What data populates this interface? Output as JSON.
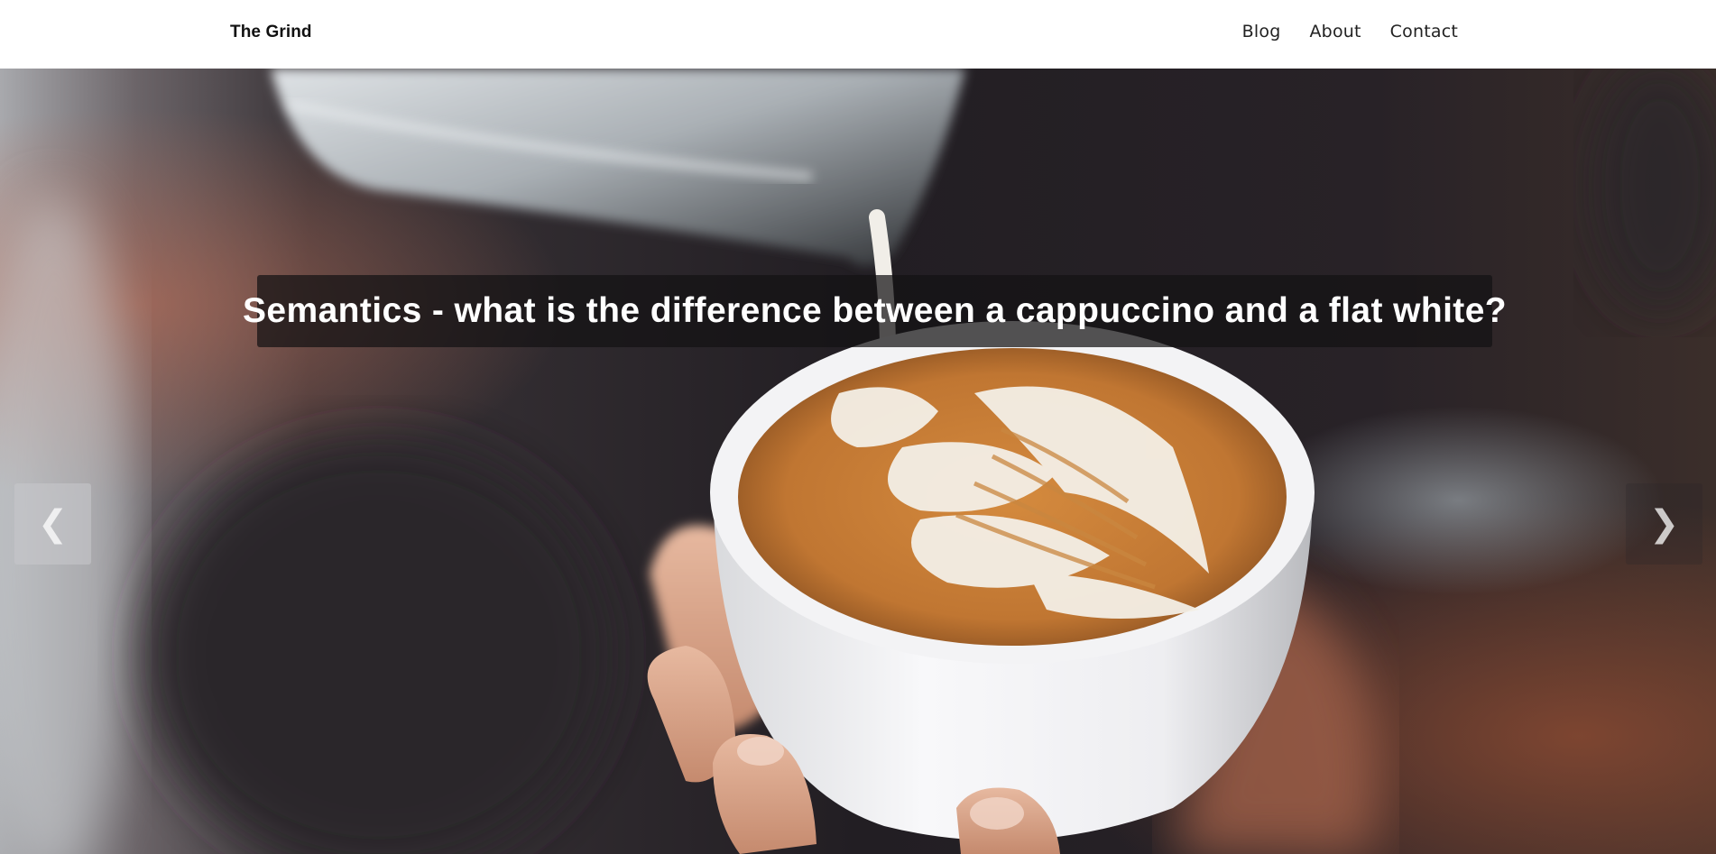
{
  "header": {
    "brand": "The Grind",
    "nav": [
      {
        "label": "Blog"
      },
      {
        "label": "About"
      },
      {
        "label": "Contact"
      }
    ]
  },
  "hero": {
    "caption": "Semantics - what is the difference between a cappuccino and a flat white?",
    "prev_glyph": "❮",
    "next_glyph": "❯",
    "image_subject": "barista pouring milk into latte art cappuccino cup"
  },
  "colors": {
    "background_dark": "#231f24",
    "coffee_crema": "#c17a34",
    "foam": "#f3f0ea",
    "cup": "#f4f4f6"
  }
}
